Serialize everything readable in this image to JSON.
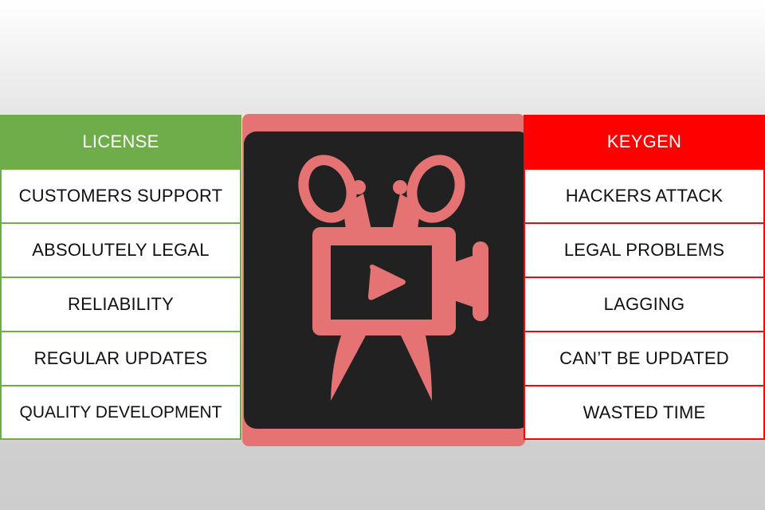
{
  "license": {
    "title": "LICENSE",
    "items": [
      "CUSTOMERS SUPPORT",
      "ABSOLUTELY LEGAL",
      "RELIABILITY",
      "REGULAR UPDATES",
      "QUALITY DEVELOPMENT"
    ]
  },
  "keygen": {
    "title": "KEYGEN",
    "items": [
      "HACKERS ATTACK",
      "LEGAL PROBLEMS",
      "LAGGING",
      "CAN’T BE UPDATED",
      "WASTED TIME"
    ]
  },
  "logo": {
    "icon": "video-editor-scissors-camera-icon",
    "accent_color": "#e57373",
    "background_color": "#212121"
  },
  "colors": {
    "license": "#6fad4a",
    "keygen": "#fe0000"
  }
}
